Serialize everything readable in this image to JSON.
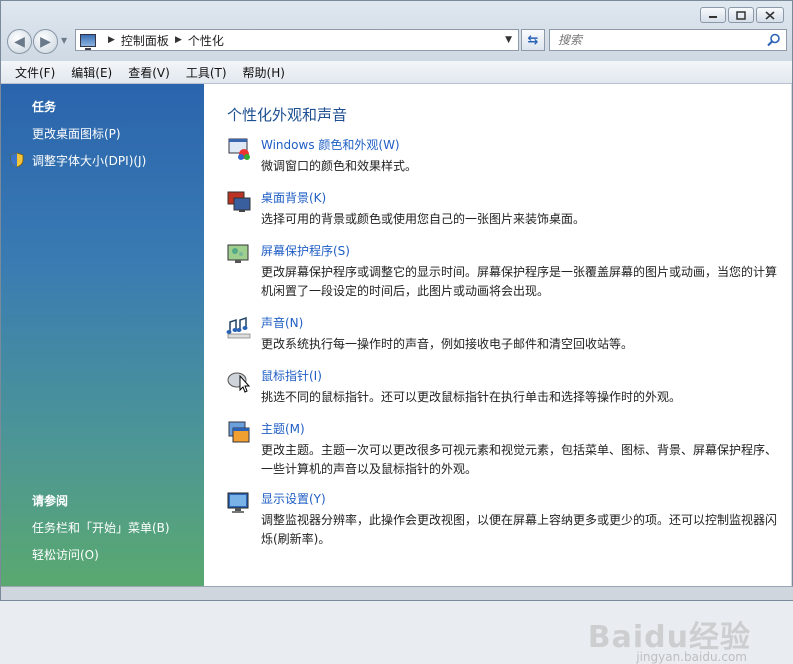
{
  "window": {
    "caption_buttons": [
      "minimize",
      "maximize",
      "close"
    ]
  },
  "address_bar": {
    "crumbs": [
      "控制面板",
      "个性化"
    ]
  },
  "search": {
    "placeholder": "搜索"
  },
  "menu": [
    "文件(F)",
    "编辑(E)",
    "查看(V)",
    "工具(T)",
    "帮助(H)"
  ],
  "sidebar": {
    "tasks_title": "任务",
    "tasks": [
      "更改桌面图标(P)",
      "调整字体大小(DPI)(J)"
    ],
    "see_also_title": "请参阅",
    "see_also": [
      "任务栏和「开始」菜单(B)",
      "轻松访问(O)"
    ]
  },
  "main": {
    "title": "个性化外观和声音",
    "items": [
      {
        "link": "Windows 颜色和外观(W)",
        "desc": "微调窗口的颜色和效果样式。",
        "icon": "window-color-icon"
      },
      {
        "link": "桌面背景(K)",
        "desc": "选择可用的背景或颜色或使用您自己的一张图片来装饰桌面。",
        "icon": "desktop-background-icon"
      },
      {
        "link": "屏幕保护程序(S)",
        "desc": "更改屏幕保护程序或调整它的显示时间。屏幕保护程序是一张覆盖屏幕的图片或动画，当您的计算机闲置了一段设定的时间后，此图片或动画将会出现。",
        "icon": "screensaver-icon"
      },
      {
        "link": "声音(N)",
        "desc": "更改系统执行每一操作时的声音，例如接收电子邮件和清空回收站等。",
        "icon": "sound-icon"
      },
      {
        "link": "鼠标指针(I)",
        "desc": "挑选不同的鼠标指针。还可以更改鼠标指针在执行单击和选择等操作时的外观。",
        "icon": "mouse-pointer-icon"
      },
      {
        "link": "主题(M)",
        "desc": "更改主题。主题一次可以更改很多可视元素和视觉元素，包括菜单、图标、背景、屏幕保护程序、一些计算机的声音以及鼠标指针的外观。",
        "icon": "theme-icon"
      },
      {
        "link": "显示设置(Y)",
        "desc": "调整监视器分辨率，此操作会更改视图，以便在屏幕上容纳更多或更少的项。还可以控制监视器闪烁(刷新率)。",
        "icon": "display-settings-icon"
      }
    ]
  },
  "watermark": {
    "text": "Baidu经验",
    "sub": "jingyan.baidu.com"
  },
  "colors": {
    "link": "#1f5ec4",
    "title": "#1d4f91",
    "sidebar_top": "#2a64ad",
    "sidebar_bottom": "#5aa96f"
  }
}
